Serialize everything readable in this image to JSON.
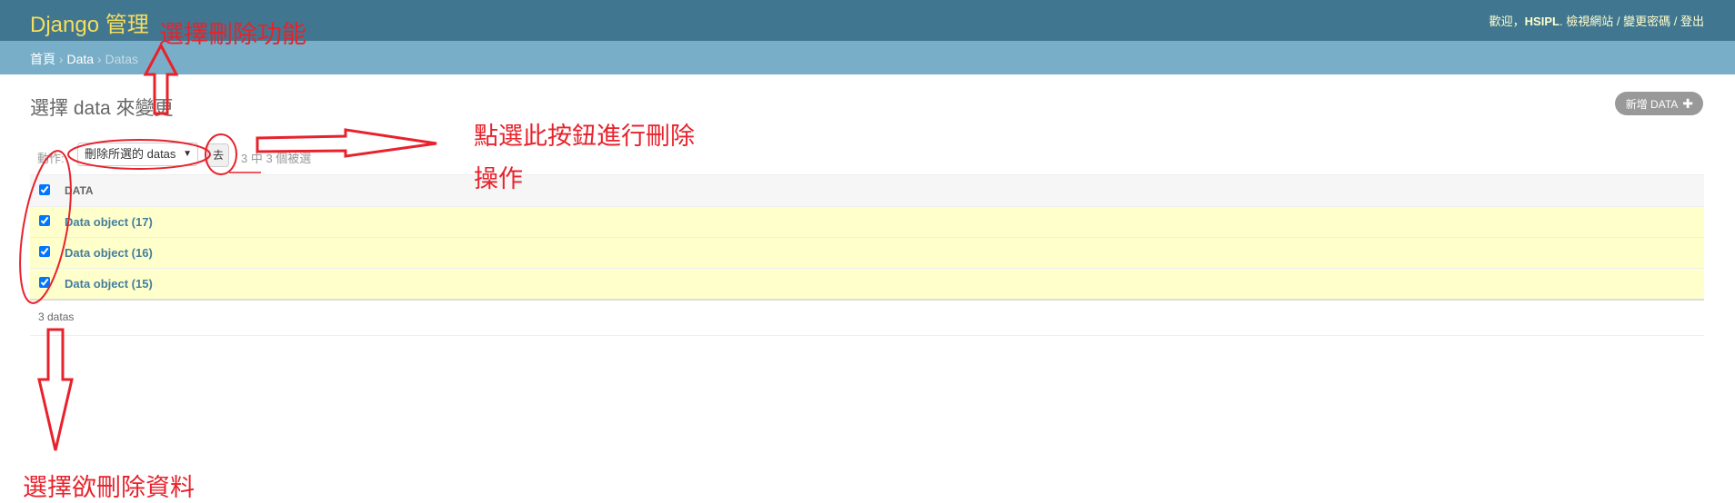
{
  "header": {
    "branding": "Django 管理",
    "welcome": "歡迎，",
    "username": "HSIPL",
    "view_site": "檢視網站",
    "change_password": "變更密碼",
    "logout": "登出",
    "separator": "/"
  },
  "breadcrumbs": {
    "home": "首頁",
    "app": "Data",
    "current": "Datas",
    "sep": "›"
  },
  "main": {
    "title": "選擇 data 來變更",
    "add_button": "新增 DATA",
    "add_icon": "plus-icon",
    "actions_label": "動作:",
    "action_selected": "刪除所選的 datas",
    "go_button": "去",
    "action_counter": "3 中 3 個被選",
    "table": {
      "header": "DATA",
      "rows": [
        {
          "label": "Data object (17)",
          "checked": true
        },
        {
          "label": "Data object (16)",
          "checked": true
        },
        {
          "label": "Data object (15)",
          "checked": true
        }
      ]
    },
    "paginator": "3 datas"
  },
  "annotations": {
    "top": "選擇刪除功能",
    "right_line1": "點選此按鈕進行刪除",
    "right_line2": "操作",
    "bottom": "選擇欲刪除資料",
    "color": "#e8222c"
  }
}
